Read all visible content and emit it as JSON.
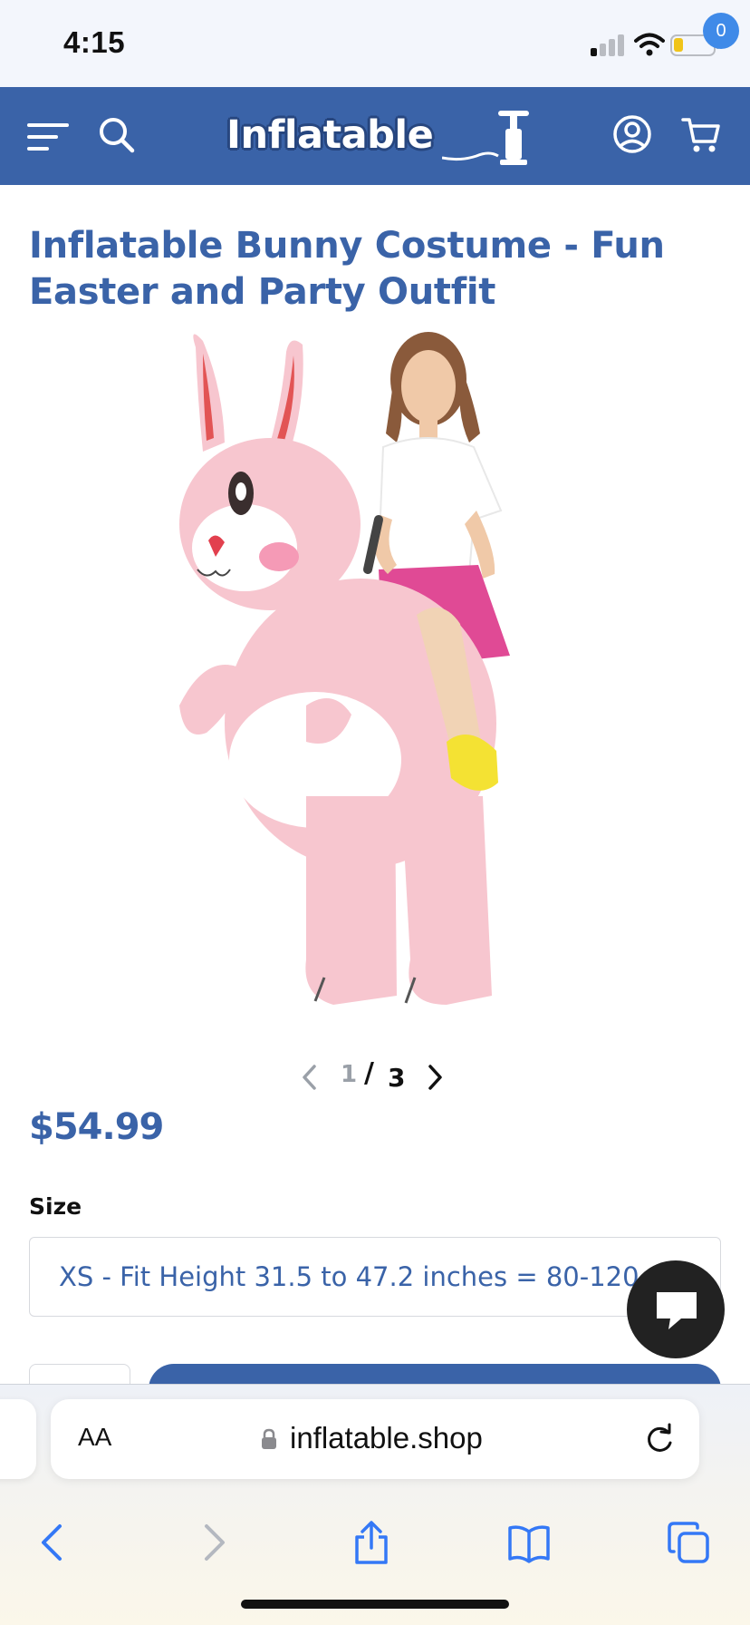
{
  "status_bar": {
    "time": "4:15",
    "battery_level": 0.22,
    "battery_color": "#f0c419"
  },
  "header": {
    "logo_text": "Inflatable",
    "cart_count": "0",
    "brand_color": "#3a63a8",
    "badge_color": "#3f8ae8",
    "icons": [
      "menu-icon",
      "search-icon",
      "account-icon",
      "cart-icon"
    ]
  },
  "product": {
    "title": "Inflatable Bunny Costume - Fun Easter and Party Outfit",
    "image_alt": "Inflatable pink bunny costume worn by a woman",
    "gallery": {
      "current": "1",
      "separator": "/",
      "total": "3"
    },
    "price": "$54.99",
    "size_label": "Size",
    "size_value": "XS - Fit Height 31.5 to 47.2 inches = 80-120 cm"
  },
  "browser": {
    "text_size_label": "AA",
    "url": "inflatable.shop",
    "icons": [
      "lock-icon",
      "reload-icon",
      "back-icon",
      "forward-icon",
      "share-icon",
      "bookmarks-icon",
      "tabs-icon"
    ]
  }
}
